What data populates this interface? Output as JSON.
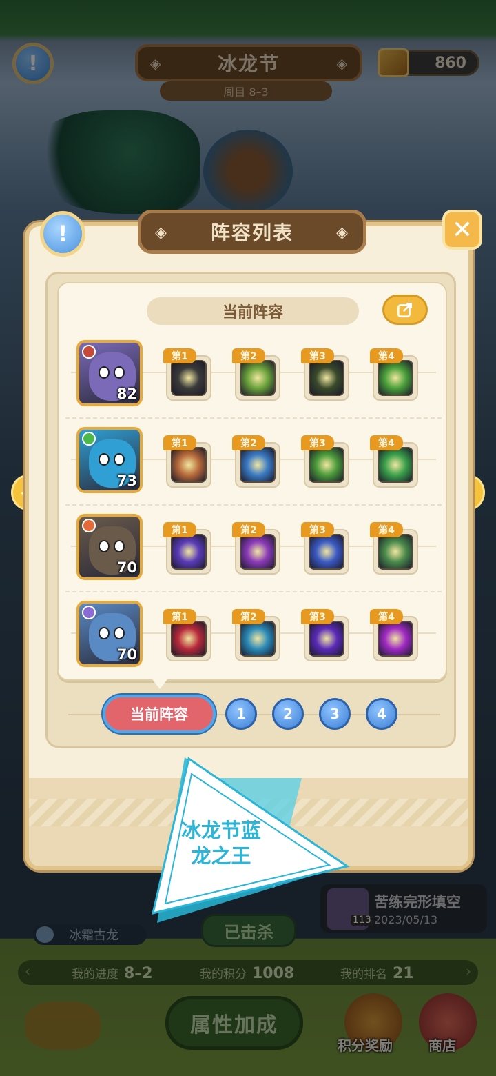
{
  "header": {
    "title": "冰龙节",
    "subtitle": "周目 8–3",
    "currency_value": "860"
  },
  "panel": {
    "title": "阵容列表",
    "card_title": "当前阵容",
    "pager": {
      "current_label": "当前阵容",
      "pages": [
        "1",
        "2",
        "3",
        "4"
      ]
    },
    "rows": [
      {
        "hero_level": "82",
        "hero_color": "#7a6ab8",
        "elem_color": "#c44a3c",
        "skills": [
          {
            "tag": "第1",
            "color": "#3a3a3a"
          },
          {
            "tag": "第2",
            "color": "#6aa23a"
          },
          {
            "tag": "第3",
            "color": "#3a4a2a"
          },
          {
            "tag": "第4",
            "color": "#4aa03a"
          }
        ]
      },
      {
        "hero_level": "73",
        "hero_color": "#2f9fd4",
        "elem_color": "#4ab84a",
        "skills": [
          {
            "tag": "第1",
            "color": "#b86a3a"
          },
          {
            "tag": "第2",
            "color": "#3a7ac4"
          },
          {
            "tag": "第3",
            "color": "#4a9a3a"
          },
          {
            "tag": "第4",
            "color": "#3aa04a"
          }
        ]
      },
      {
        "hero_level": "70",
        "hero_color": "#6a5a4a",
        "elem_color": "#e46a3a",
        "skills": [
          {
            "tag": "第1",
            "color": "#5a3ab8"
          },
          {
            "tag": "第2",
            "color": "#8a3ab8"
          },
          {
            "tag": "第3",
            "color": "#3a5ac4"
          },
          {
            "tag": "第4",
            "color": "#4a8a4a"
          }
        ]
      },
      {
        "hero_level": "70",
        "hero_color": "#5a8ac4",
        "elem_color": "#8a6ad4",
        "skills": [
          {
            "tag": "第1",
            "color": "#b82a3a"
          },
          {
            "tag": "第2",
            "color": "#2a8ab8"
          },
          {
            "tag": "第3",
            "color": "#5a2ab8"
          },
          {
            "tag": "第4",
            "color": "#a02ac4"
          }
        ]
      }
    ]
  },
  "background": {
    "dragon_label": "冰霜古龙",
    "killed_label": "已击杀",
    "event": {
      "level": "113",
      "name": "苦练完形填空",
      "date": "2023/05/13"
    },
    "progress": {
      "progress_label": "我的进度",
      "progress_value": "8–2",
      "score_label": "我的积分",
      "score_value": "1008",
      "rank_label": "我的排名",
      "rank_value": "21"
    },
    "attr_button": "属性加成",
    "reward_label": "积分奖励",
    "shop_label": "商店"
  },
  "overlay": {
    "line1": "冰龙节蓝",
    "line2": "龙之王"
  },
  "colors": {
    "accent_orange": "#e79a1f",
    "pager_red": "#e2656c",
    "pager_blue": "#3d7fd6",
    "banner_cyan": "#2bb6d9"
  }
}
